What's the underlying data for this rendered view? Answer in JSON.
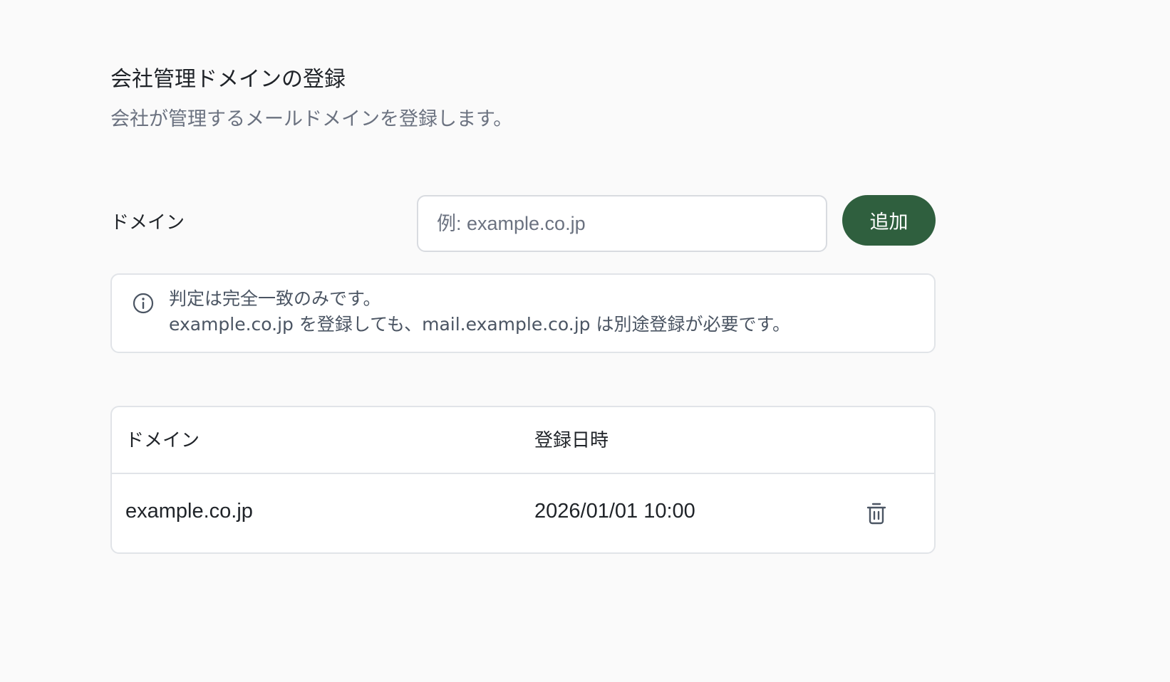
{
  "header": {
    "title": "会社管理ドメインの登録",
    "subtitle": "会社が管理するメールドメインを登録します。"
  },
  "form": {
    "domain_label": "ドメイン",
    "domain_input_value": "",
    "domain_input_placeholder": "例: example.co.jp",
    "add_button_label": "追加",
    "accent_color": "#2f5f3e"
  },
  "notice": {
    "icon": "info-icon",
    "lines": [
      "判定は完全一致のみです。",
      "example.co.jp を登録しても、mail.example.co.jp は別途登録が必要です。"
    ]
  },
  "table": {
    "columns": [
      "ドメイン",
      "登録日時"
    ],
    "rows": [
      {
        "domain": "example.co.jp",
        "registered_at": "2026/01/01 10:00",
        "action_icon": "trash-icon"
      }
    ]
  }
}
